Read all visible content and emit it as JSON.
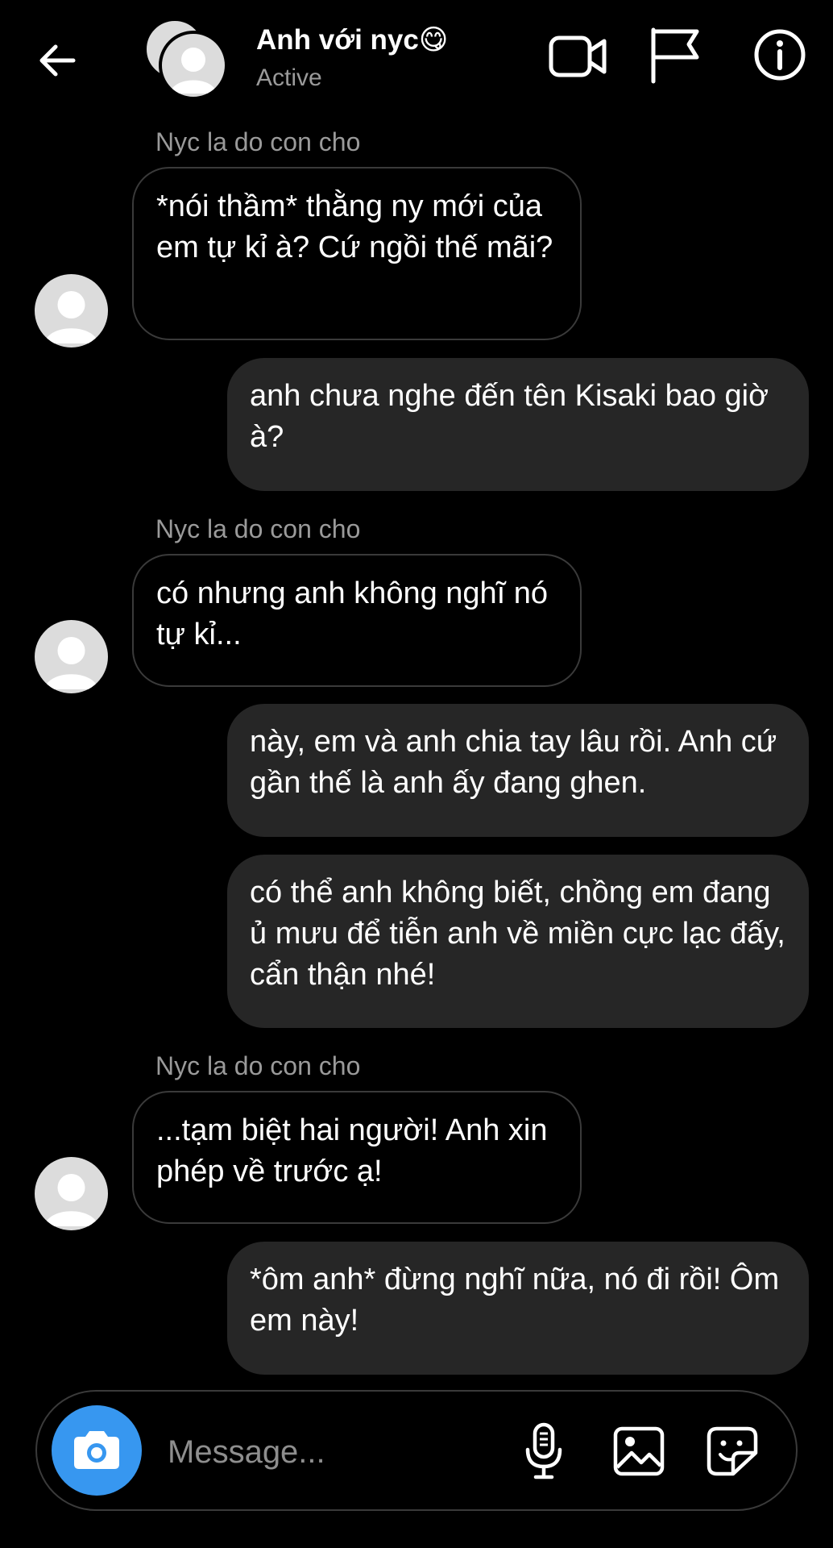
{
  "header": {
    "title": "Anh với nyc",
    "emoji": "😋",
    "status": "Active",
    "icons": [
      "back-arrow-icon",
      "video-call-icon",
      "flag-icon",
      "info-icon"
    ]
  },
  "messages": [
    {
      "direction": "in",
      "sender": "Nyc la do con cho",
      "text": "*nói thầm* thằng ny mới của em tự kỉ à? Cứ ngồi thế mãi?"
    },
    {
      "direction": "out",
      "text": "anh chưa nghe đến tên Kisaki bao giờ à?"
    },
    {
      "direction": "in",
      "sender": "Nyc la do con cho",
      "text": "có nhưng anh không nghĩ nó tự kỉ..."
    },
    {
      "direction": "out",
      "text": "này, em và anh chia tay lâu rồi. Anh cứ gần thế là anh ấy đang ghen."
    },
    {
      "direction": "out",
      "text": "có thể anh không biết, chồng em đang ủ mưu để tiễn anh về miền cực lạc đấy, cẩn thận nhé!"
    },
    {
      "direction": "in",
      "sender": "Nyc la do con cho",
      "text": "...tạm biệt hai người! Anh xin phép về trước ạ!"
    },
    {
      "direction": "out",
      "text": "*ôm anh* đừng nghĩ nữa, nó đi rồi! Ôm em này!"
    }
  ],
  "composer": {
    "placeholder": "Message...",
    "camera_color": "#3797f0",
    "icons": [
      "camera-icon",
      "microphone-icon",
      "gallery-icon",
      "sticker-icon"
    ]
  }
}
